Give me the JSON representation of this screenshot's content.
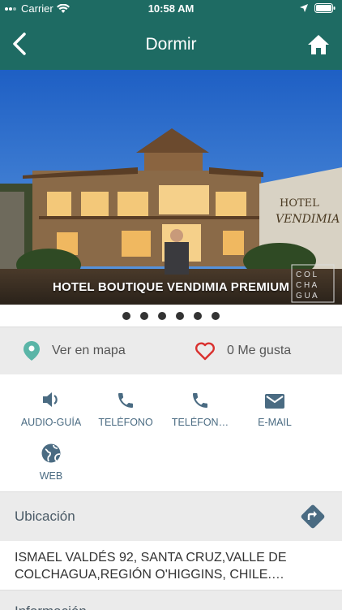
{
  "status_bar": {
    "carrier": "Carrier",
    "time": "10:58 AM"
  },
  "nav": {
    "title": "Dormir",
    "back_icon": "chevron-left-icon",
    "home_icon": "home-icon"
  },
  "hero": {
    "caption": "HOTEL BOUTIQUE VENDIMIA PREMIUM",
    "carousel_dots": 6,
    "sign_text": "HOTEL VENDIMIA",
    "watermark": [
      "C O L",
      "C H A",
      "G U A"
    ]
  },
  "actions": {
    "map_label": "Ver en mapa",
    "like_label": "0 Me gusta",
    "map_icon_color": "#5ab5a7",
    "like_icon_color": "#d9302e"
  },
  "contact_items": [
    {
      "id": "audio",
      "label": "AUDIO-GUÍA",
      "icon": "speaker-icon"
    },
    {
      "id": "phone1",
      "label": "TELÉFONO",
      "icon": "phone-icon"
    },
    {
      "id": "phone2",
      "label": "TELÉFON…",
      "icon": "phone-icon"
    },
    {
      "id": "email",
      "label": "E-MAIL",
      "icon": "mail-icon"
    },
    {
      "id": "web",
      "label": "WEB",
      "icon": "globe-icon"
    }
  ],
  "location": {
    "title": "Ubicación",
    "address": "ISMAEL VALDÉS 92, SANTA CRUZ,VALLE DE COLCHAGUA,REGIÓN O'HIGGINS, CHILE.…"
  },
  "info": {
    "title": "Información"
  },
  "colors": {
    "header": "#1e6b63",
    "icon_blue": "#4a6b82"
  }
}
